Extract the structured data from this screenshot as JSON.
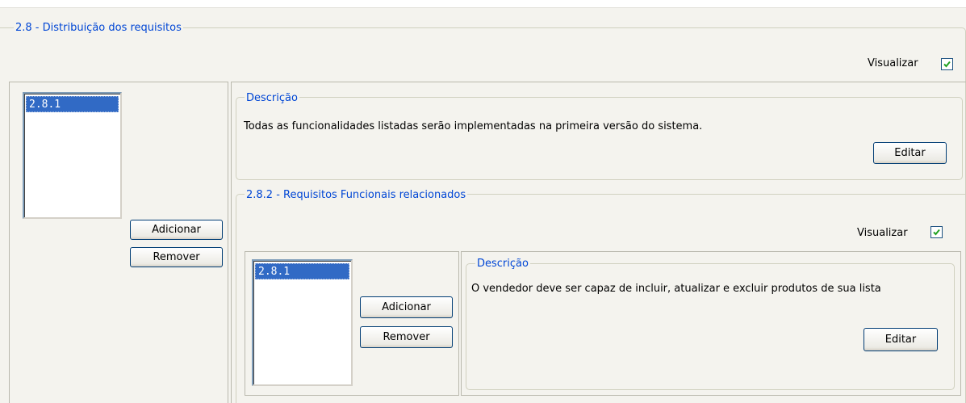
{
  "section": {
    "title": "2.8 - Distribuição dos requisitos",
    "visualizar_label": "Visualizar",
    "visualizar_checked": true,
    "list_items": [
      "2.8.1"
    ],
    "add_button": "Adicionar",
    "remove_button": "Remover"
  },
  "descricao": {
    "title": "Descrição",
    "text": "Todas as funcionalidades listadas serão implementadas na primeira versão do sistema.",
    "edit_button": "Editar"
  },
  "functional": {
    "title": "2.8.2 - Requisitos Funcionais relacionados",
    "visualizar_label": "Visualizar",
    "visualizar_checked": true,
    "list_items": [
      "2.8.1"
    ],
    "add_button": "Adicionar",
    "remove_button": "Remover",
    "descricao": {
      "title": "Descrição",
      "text": "O vendedor deve ser capaz de incluir, atualizar e excluir produtos de sua lista",
      "edit_button": "Editar"
    }
  },
  "colors": {
    "legend": "#0046d5",
    "selection": "#316ac5",
    "check": "#21a121"
  },
  "icons": [
    "checkmark-icon"
  ]
}
